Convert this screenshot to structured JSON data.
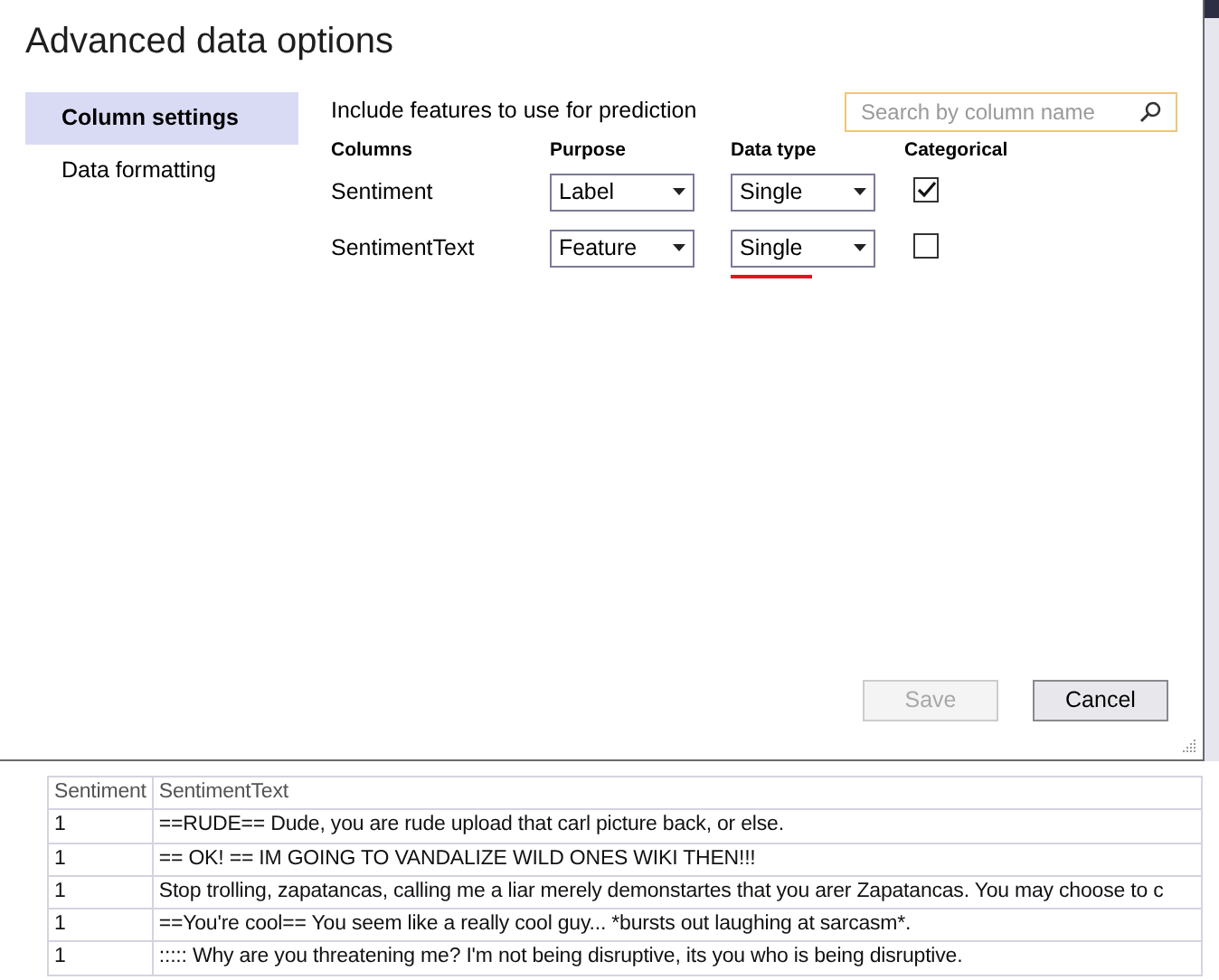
{
  "dialog": {
    "title": "Advanced data options",
    "sidebar": {
      "items": [
        {
          "label": "Column settings",
          "selected": true
        },
        {
          "label": "Data formatting",
          "selected": false
        }
      ]
    },
    "heading": "Include features to use for prediction",
    "search": {
      "placeholder": "Search by column name"
    },
    "columns": [
      "Columns",
      "Purpose",
      "Data type",
      "Categorical"
    ],
    "rows": [
      {
        "name": "Sentiment",
        "purpose": "Label",
        "data_type": "Single",
        "data_type_error": false,
        "categorical": true
      },
      {
        "name": "SentimentText",
        "purpose": "Feature",
        "data_type": "Single",
        "data_type_error": true,
        "categorical": false
      }
    ],
    "buttons": [
      {
        "label": "Save",
        "disabled": true
      },
      {
        "label": "Cancel",
        "disabled": false
      }
    ]
  },
  "grid": {
    "columns": [
      "Sentiment",
      "SentimentText"
    ],
    "rows": [
      [
        "1",
        "==RUDE== Dude, you are rude upload that carl picture back, or else."
      ],
      [
        "1",
        "== OK! ==  IM GOING TO VANDALIZE WILD ONES WIKI THEN!!!"
      ],
      [
        "1",
        "Stop trolling, zapatancas, calling me a liar merely demonstartes that you arer Zapatancas. You may choose to c"
      ],
      [
        "1",
        "==You're cool==  You seem like a really cool guy... *bursts out laughing at sarcasm*."
      ],
      [
        "1",
        "::::: Why are you threatening me? I'm not being disruptive, its you who is being disruptive."
      ]
    ]
  }
}
